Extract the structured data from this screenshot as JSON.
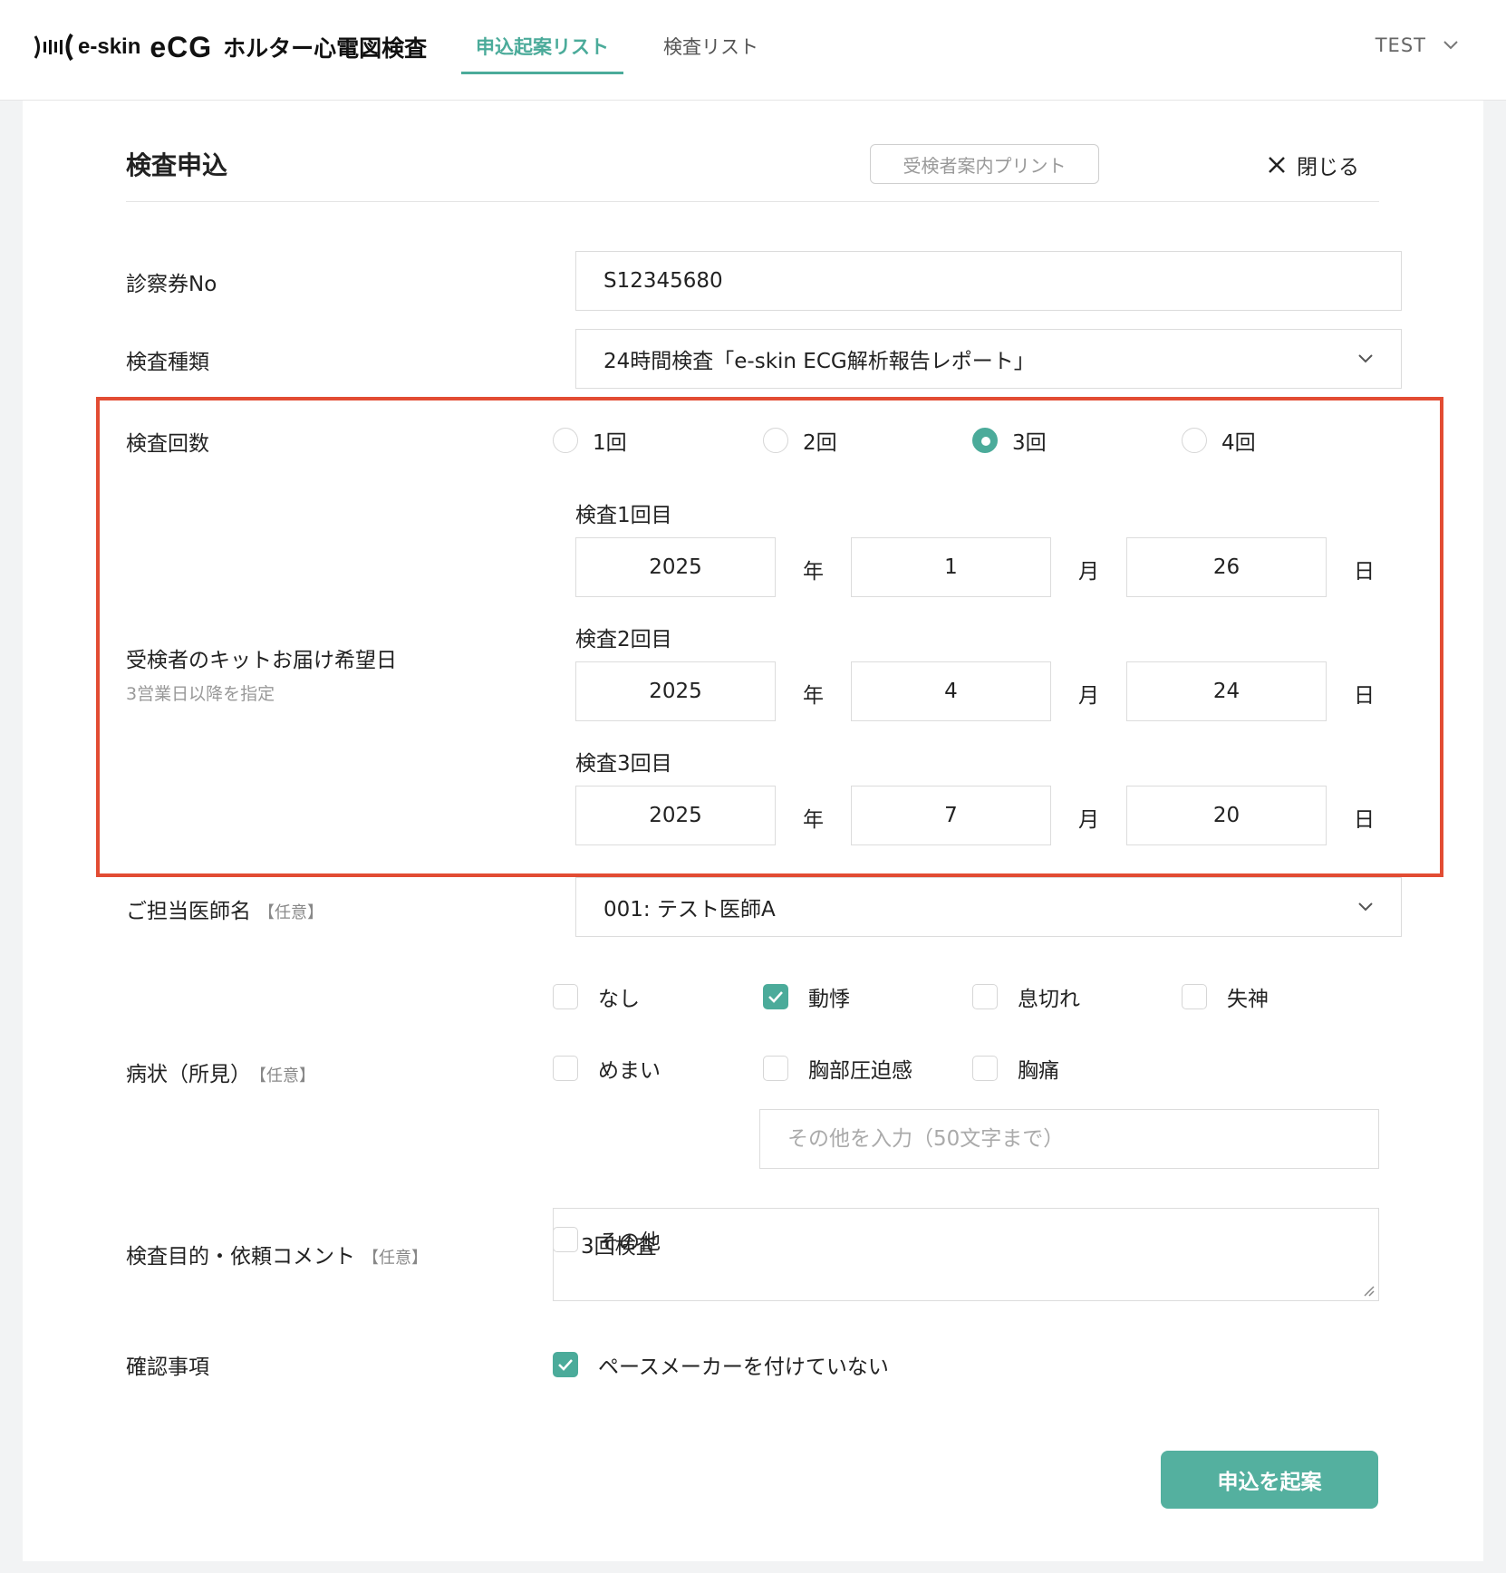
{
  "header": {
    "brand_small": "e-skin",
    "brand_big": "eCG",
    "app_title": "ホルター心電図検査",
    "tabs": [
      {
        "label": "申込起案リスト",
        "active": true
      },
      {
        "label": "検査リスト",
        "active": false
      }
    ],
    "user": "TEST",
    "accent_color": "#4bab9a"
  },
  "form": {
    "title": "検査申込",
    "print_label": "受検者案内プリント",
    "close_label": "閉じる",
    "patient_no": {
      "label": "診察券No",
      "value": "S12345680"
    },
    "exam_type": {
      "label": "検査種類",
      "value": "24時間検査「e-skin ECG解析報告レポート」"
    },
    "exam_count": {
      "label": "検査回数",
      "options": [
        "1回",
        "2回",
        "3回",
        "4回"
      ],
      "selected": "3回"
    },
    "delivery": {
      "label": "受検者のキットお届け希望日",
      "note": "3営業日以降を指定",
      "year_unit": "年",
      "month_unit": "月",
      "day_unit": "日",
      "dates": [
        {
          "label": "検査1回目",
          "year": "2025",
          "month": "1",
          "day": "26"
        },
        {
          "label": "検査2回目",
          "year": "2025",
          "month": "4",
          "day": "24"
        },
        {
          "label": "検査3回目",
          "year": "2025",
          "month": "7",
          "day": "20"
        }
      ]
    },
    "optional_tag": "【任意】",
    "doctor": {
      "label": "ご担当医師名",
      "value": "001: テスト医師A"
    },
    "symptoms": {
      "label": "病状（所見）",
      "options": [
        {
          "label": "なし",
          "checked": false
        },
        {
          "label": "動悸",
          "checked": true
        },
        {
          "label": "息切れ",
          "checked": false
        },
        {
          "label": "失神",
          "checked": false
        },
        {
          "label": "めまい",
          "checked": false
        },
        {
          "label": "胸部圧迫感",
          "checked": false
        },
        {
          "label": "胸痛",
          "checked": false
        },
        {
          "label": "その他",
          "checked": false
        }
      ],
      "other_placeholder": "その他を入力（50文字まで）"
    },
    "purpose": {
      "label": "検査目的・依頼コメント",
      "value": "3回検査"
    },
    "confirm": {
      "label": "確認事項",
      "item": "ペースメーカーを付けていない",
      "checked": true
    },
    "submit_label": "申込を起案"
  }
}
